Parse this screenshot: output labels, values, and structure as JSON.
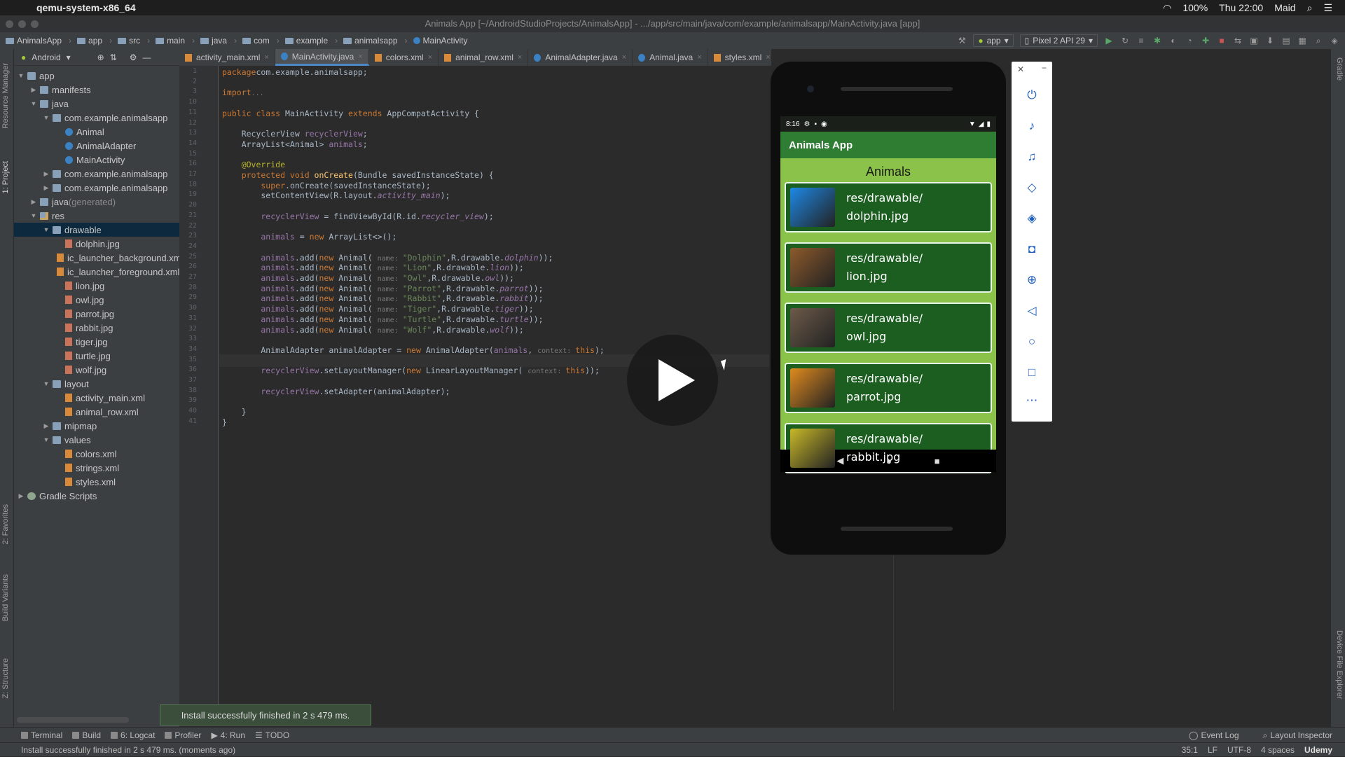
{
  "menubar": {
    "app_name": "qemu-system-x86_64",
    "battery": "100%",
    "time": "Thu 22:00",
    "user": "Maid"
  },
  "window_title": "Animals App [~/AndroidStudioProjects/AnimalsApp] - .../app/src/main/java/com/example/animalsapp/MainActivity.java [app]",
  "breadcrumbs": [
    "AnimalsApp",
    "app",
    "src",
    "main",
    "java",
    "com",
    "example",
    "animalsapp",
    "MainActivity"
  ],
  "run_config": "app",
  "device": "Pixel 2 API 29",
  "project_view": "Android",
  "tree": [
    {
      "label": "app",
      "indent": 0,
      "arrow": "▼",
      "icon": "folder"
    },
    {
      "label": "manifests",
      "indent": 1,
      "arrow": "▶",
      "icon": "folder"
    },
    {
      "label": "java",
      "indent": 1,
      "arrow": "▼",
      "icon": "folder"
    },
    {
      "label": "com.example.animalsapp",
      "indent": 2,
      "arrow": "▼",
      "icon": "folder"
    },
    {
      "label": "Animal",
      "indent": 3,
      "arrow": "",
      "icon": "class"
    },
    {
      "label": "AnimalAdapter",
      "indent": 3,
      "arrow": "",
      "icon": "class"
    },
    {
      "label": "MainActivity",
      "indent": 3,
      "arrow": "",
      "icon": "class"
    },
    {
      "label": "com.example.animalsapp",
      "indent": 2,
      "arrow": "▶",
      "icon": "folder"
    },
    {
      "label": "com.example.animalsapp",
      "indent": 2,
      "arrow": "▶",
      "icon": "folder"
    },
    {
      "label": "java",
      "suffix": " (generated)",
      "indent": 1,
      "arrow": "▶",
      "icon": "folder"
    },
    {
      "label": "res",
      "indent": 1,
      "arrow": "▼",
      "icon": "res"
    },
    {
      "label": "drawable",
      "indent": 2,
      "arrow": "▼",
      "icon": "folder",
      "selected": true
    },
    {
      "label": "dolphin.jpg",
      "indent": 3,
      "arrow": "",
      "icon": "img"
    },
    {
      "label": "ic_launcher_background.xml",
      "indent": 3,
      "arrow": "",
      "icon": "xml"
    },
    {
      "label": "ic_launcher_foreground.xml",
      "indent": 3,
      "arrow": "",
      "icon": "xml"
    },
    {
      "label": "lion.jpg",
      "indent": 3,
      "arrow": "",
      "icon": "img"
    },
    {
      "label": "owl.jpg",
      "indent": 3,
      "arrow": "",
      "icon": "img"
    },
    {
      "label": "parrot.jpg",
      "indent": 3,
      "arrow": "",
      "icon": "img"
    },
    {
      "label": "rabbit.jpg",
      "indent": 3,
      "arrow": "",
      "icon": "img"
    },
    {
      "label": "tiger.jpg",
      "indent": 3,
      "arrow": "",
      "icon": "img"
    },
    {
      "label": "turtle.jpg",
      "indent": 3,
      "arrow": "",
      "icon": "img"
    },
    {
      "label": "wolf.jpg",
      "indent": 3,
      "arrow": "",
      "icon": "img"
    },
    {
      "label": "layout",
      "indent": 2,
      "arrow": "▼",
      "icon": "folder"
    },
    {
      "label": "activity_main.xml",
      "indent": 3,
      "arrow": "",
      "icon": "xml"
    },
    {
      "label": "animal_row.xml",
      "indent": 3,
      "arrow": "",
      "icon": "xml"
    },
    {
      "label": "mipmap",
      "indent": 2,
      "arrow": "▶",
      "icon": "folder"
    },
    {
      "label": "values",
      "indent": 2,
      "arrow": "▼",
      "icon": "folder"
    },
    {
      "label": "colors.xml",
      "indent": 3,
      "arrow": "",
      "icon": "xml"
    },
    {
      "label": "strings.xml",
      "indent": 3,
      "arrow": "",
      "icon": "xml"
    },
    {
      "label": "styles.xml",
      "indent": 3,
      "arrow": "",
      "icon": "xml"
    },
    {
      "label": "Gradle Scripts",
      "indent": 0,
      "arrow": "▶",
      "icon": "gradle"
    }
  ],
  "tabs": [
    {
      "label": "activity_main.xml",
      "kind": "xml"
    },
    {
      "label": "MainActivity.java",
      "kind": "class",
      "active": true
    },
    {
      "label": "colors.xml",
      "kind": "xml"
    },
    {
      "label": "animal_row.xml",
      "kind": "xml"
    },
    {
      "label": "AnimalAdapter.java",
      "kind": "class"
    },
    {
      "label": "Animal.java",
      "kind": "class"
    },
    {
      "label": "styles.xml",
      "kind": "xml"
    }
  ],
  "line_numbers": [
    "1",
    "2",
    "3",
    "10",
    "11",
    "12",
    "13",
    "14",
    "15",
    "16",
    "17",
    "18",
    "19",
    "20",
    "21",
    "22",
    "23",
    "24",
    "25",
    "26",
    "27",
    "28",
    "29",
    "30",
    "31",
    "32",
    "33",
    "34",
    "35",
    "36",
    "37",
    "38",
    "39",
    "40",
    "41"
  ],
  "code_lines": [
    [
      [
        "kw",
        "package"
      ],
      [
        "",
        "com.example.animalsapp;"
      ]
    ],
    [],
    [
      [
        "kw",
        "import"
      ],
      [
        "",
        ""
      ],
      [
        "hint",
        "..."
      ]
    ],
    [],
    [
      [
        "kw",
        "public class"
      ],
      [
        "",
        " MainActivity "
      ],
      [
        "kw",
        "extends"
      ],
      [
        "",
        " AppCompatActivity {"
      ]
    ],
    [],
    [
      [
        "",
        "    RecyclerView "
      ],
      [
        "fld",
        "recyclerView"
      ],
      [
        "",
        ";"
      ]
    ],
    [
      [
        "",
        "    ArrayList<Animal> "
      ],
      [
        "fld",
        "animals"
      ],
      [
        "",
        ";"
      ]
    ],
    [],
    [
      [
        "ann",
        "    @Override"
      ]
    ],
    [
      [
        "kw",
        "    protected void"
      ],
      [
        "fn",
        " onCreate"
      ],
      [
        "",
        "(Bundle savedInstanceState) {"
      ]
    ],
    [
      [
        "kw",
        "        super"
      ],
      [
        "",
        ".onCreate(savedInstanceState);"
      ]
    ],
    [
      [
        "",
        "        setContentView(R.layout."
      ],
      [
        "fld it",
        "activity_main"
      ],
      [
        "",
        ");"
      ]
    ],
    [],
    [
      [
        "fld",
        "        recyclerView"
      ],
      [
        "",
        " = findViewById(R.id."
      ],
      [
        "fld it",
        "recycler_view"
      ],
      [
        "",
        ");"
      ]
    ],
    [],
    [
      [
        "fld",
        "        animals"
      ],
      [
        "",
        " = "
      ],
      [
        "kw",
        "new"
      ],
      [
        "",
        " ArrayList<>();"
      ]
    ],
    [],
    [
      [
        "fld",
        "        animals"
      ],
      [
        "",
        ".add("
      ],
      [
        "kw",
        "new"
      ],
      [
        "",
        " Animal( "
      ],
      [
        "hint",
        "name: "
      ],
      [
        "str",
        "\"Dolphin\""
      ],
      [
        "",
        ",R.drawable."
      ],
      [
        "fld it",
        "dolphin"
      ],
      [
        "",
        "));"
      ]
    ],
    [
      [
        "fld",
        "        animals"
      ],
      [
        "",
        ".add("
      ],
      [
        "kw",
        "new"
      ],
      [
        "",
        " Animal( "
      ],
      [
        "hint",
        "name: "
      ],
      [
        "str",
        "\"Lion\""
      ],
      [
        "",
        ",R.drawable."
      ],
      [
        "fld it",
        "lion"
      ],
      [
        "",
        "));"
      ]
    ],
    [
      [
        "fld",
        "        animals"
      ],
      [
        "",
        ".add("
      ],
      [
        "kw",
        "new"
      ],
      [
        "",
        " Animal( "
      ],
      [
        "hint",
        "name: "
      ],
      [
        "str",
        "\"Owl\""
      ],
      [
        "",
        ",R.drawable."
      ],
      [
        "fld it",
        "owl"
      ],
      [
        "",
        "));"
      ]
    ],
    [
      [
        "fld",
        "        animals"
      ],
      [
        "",
        ".add("
      ],
      [
        "kw",
        "new"
      ],
      [
        "",
        " Animal( "
      ],
      [
        "hint",
        "name: "
      ],
      [
        "str",
        "\"Parrot\""
      ],
      [
        "",
        ",R.drawable."
      ],
      [
        "fld it",
        "parrot"
      ],
      [
        "",
        "));"
      ]
    ],
    [
      [
        "fld",
        "        animals"
      ],
      [
        "",
        ".add("
      ],
      [
        "kw",
        "new"
      ],
      [
        "",
        " Animal( "
      ],
      [
        "hint",
        "name: "
      ],
      [
        "str",
        "\"Rabbit\""
      ],
      [
        "",
        ",R.drawable."
      ],
      [
        "fld it",
        "rabbit"
      ],
      [
        "",
        "));"
      ]
    ],
    [
      [
        "fld",
        "        animals"
      ],
      [
        "",
        ".add("
      ],
      [
        "kw",
        "new"
      ],
      [
        "",
        " Animal( "
      ],
      [
        "hint",
        "name: "
      ],
      [
        "str",
        "\"Tiger\""
      ],
      [
        "",
        ",R.drawable."
      ],
      [
        "fld it",
        "tiger"
      ],
      [
        "",
        "));"
      ]
    ],
    [
      [
        "fld",
        "        animals"
      ],
      [
        "",
        ".add("
      ],
      [
        "kw",
        "new"
      ],
      [
        "",
        " Animal( "
      ],
      [
        "hint",
        "name: "
      ],
      [
        "str",
        "\"Turtle\""
      ],
      [
        "",
        ",R.drawable."
      ],
      [
        "fld it",
        "turtle"
      ],
      [
        "",
        "));"
      ]
    ],
    [
      [
        "fld",
        "        animals"
      ],
      [
        "",
        ".add("
      ],
      [
        "kw",
        "new"
      ],
      [
        "",
        " Animal( "
      ],
      [
        "hint",
        "name: "
      ],
      [
        "str",
        "\"Wolf\""
      ],
      [
        "",
        ",R.drawable."
      ],
      [
        "fld it",
        "wolf"
      ],
      [
        "",
        "));"
      ]
    ],
    [],
    [
      [
        "",
        "        AnimalAdapter animalAdapter = "
      ],
      [
        "kw",
        "new"
      ],
      [
        "",
        " AnimalAdapter("
      ],
      [
        "fld",
        "animals"
      ],
      [
        "",
        ", "
      ],
      [
        "hint",
        "context: "
      ],
      [
        "kw",
        "this"
      ],
      [
        "",
        ");"
      ]
    ],
    [],
    [
      [
        "fld",
        "        recyclerView"
      ],
      [
        "",
        ".setLayoutManager("
      ],
      [
        "kw",
        "new"
      ],
      [
        "",
        " LinearLayoutManager( "
      ],
      [
        "hint",
        "context: "
      ],
      [
        "kw",
        "this"
      ],
      [
        "",
        "));"
      ]
    ],
    [],
    [
      [
        "fld",
        "        recyclerView"
      ],
      [
        "",
        ".setAdapter(animalAdapter);"
      ]
    ],
    [],
    [
      [
        "",
        "    }"
      ]
    ],
    [
      [
        "",
        "}"
      ]
    ]
  ],
  "phone": {
    "clock": "8:16",
    "app_title": "Animals App",
    "header": "Animals",
    "rows": [
      {
        "line1": "res/drawable/",
        "line2": "dolphin.jpg",
        "color": "#1e88e5"
      },
      {
        "line1": "res/drawable/",
        "line2": "lion.jpg",
        "color": "#8d5a2b"
      },
      {
        "line1": "res/drawable/",
        "line2": "owl.jpg",
        "color": "#6d5a4a"
      },
      {
        "line1": "res/drawable/",
        "line2": "parrot.jpg",
        "color": "#e08a1e"
      },
      {
        "line1": "res/drawable/",
        "line2": "rabbit.jpg",
        "color": "#c8b828"
      }
    ]
  },
  "emulator_controls": [
    "power-icon",
    "volume-up-icon",
    "volume-down-icon",
    "rotate-left-icon",
    "rotate-right-icon",
    "camera-icon",
    "zoom-icon",
    "back-icon",
    "home-icon",
    "overview-icon",
    "more-icon"
  ],
  "toast": "Install successfully finished in 2 s 479 ms.",
  "toolwindows": [
    "Terminal",
    "Build",
    "6: Logcat",
    "Profiler",
    "4: Run",
    "TODO"
  ],
  "toolwindows_right": [
    "Event Log",
    "Layout Inspector"
  ],
  "side_tabs_left": [
    "Resource Manager",
    "1: Project",
    "2: Favorites",
    "Build Variants",
    "Z: Structure"
  ],
  "side_tabs_right": [
    "Gradle",
    "Device File Explorer"
  ],
  "status_message": "Install successfully finished in 2 s 479 ms. (moments ago)",
  "status_right": [
    "35:1",
    "LF",
    "UTF-8",
    "4 spaces"
  ],
  "watermark": "Udemy"
}
